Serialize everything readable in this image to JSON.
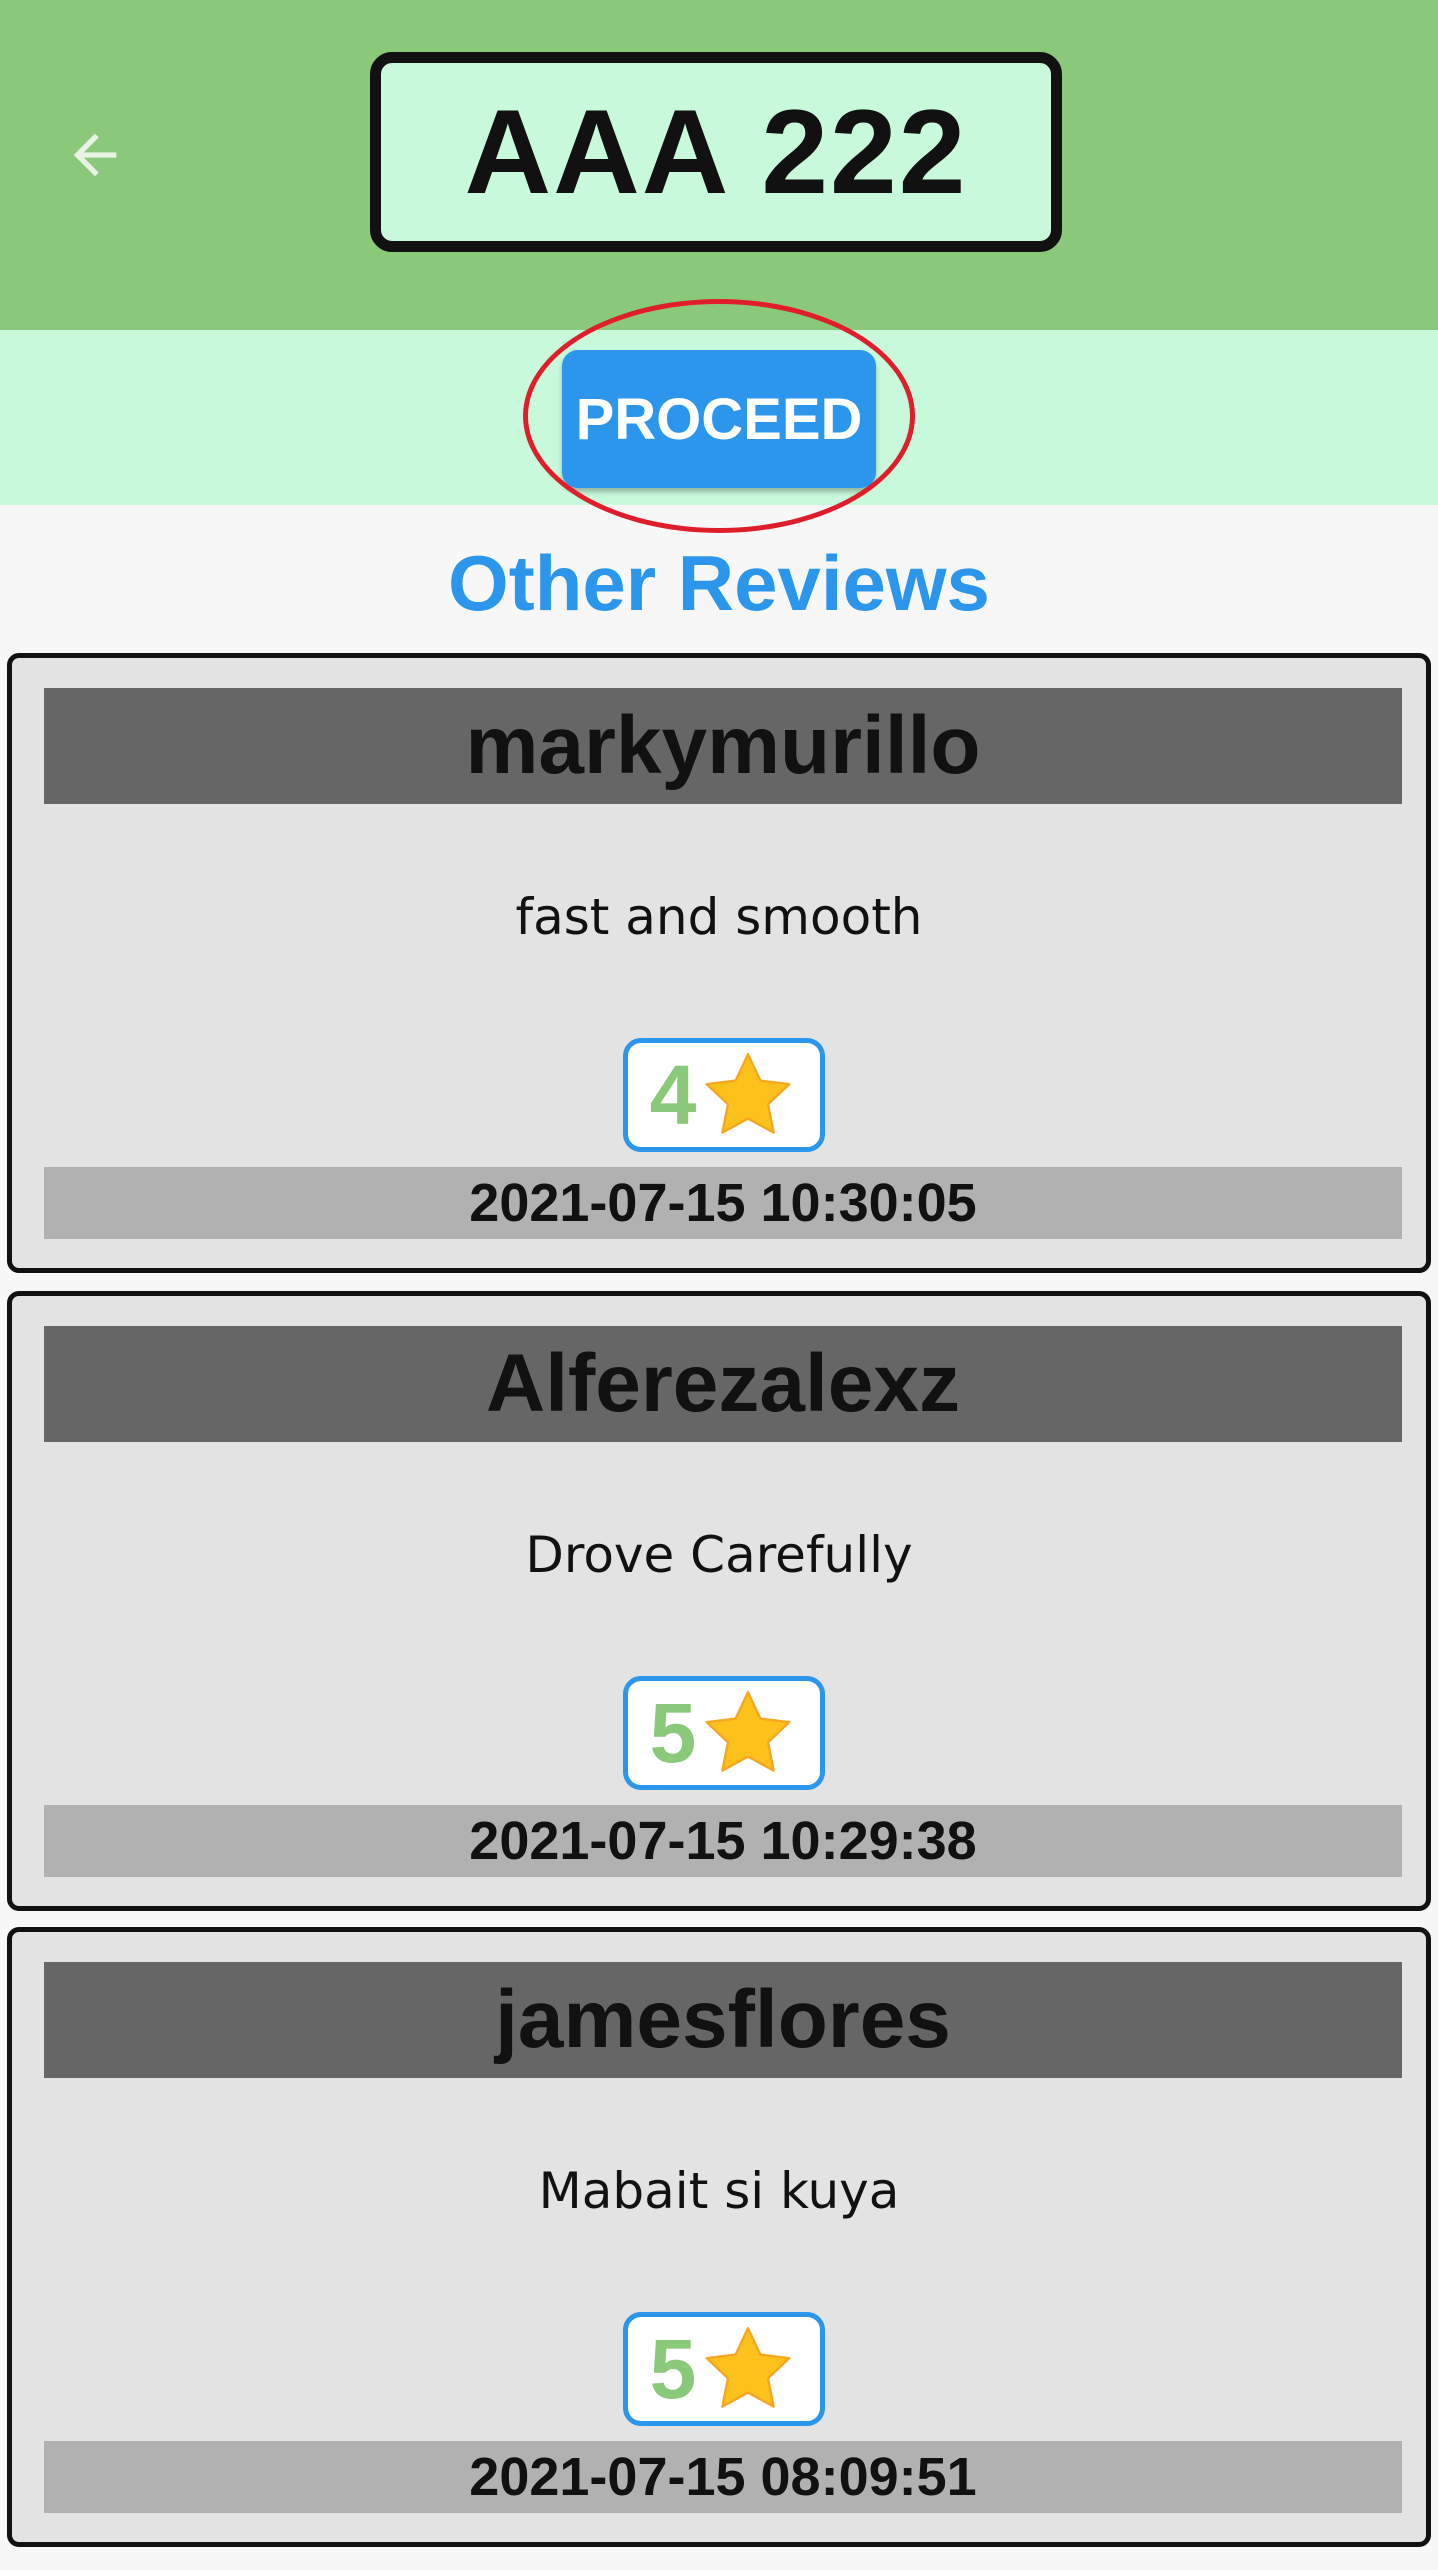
{
  "header": {
    "plate_number": "AAA 222",
    "back_icon": "arrow-left-icon",
    "background_color": "#8ac87a"
  },
  "actions": {
    "proceed_label": "PROCEED",
    "proceed_color": "#2b96ec",
    "highlight_color": "#e01e2b"
  },
  "reviews_section": {
    "title": "Other Reviews",
    "title_color": "#2b96ec"
  },
  "reviews": [
    {
      "username": "markymurillo",
      "comment": "fast and smooth",
      "rating": "4",
      "date": "2021-07-15 10:30:05"
    },
    {
      "username": "Alferezalexz",
      "comment": "Drove Carefully",
      "rating": "5",
      "date": "2021-07-15 10:29:38"
    },
    {
      "username": "jamesflores",
      "comment": "Mabait si kuya",
      "rating": "5",
      "date": "2021-07-15 08:09:51"
    }
  ],
  "icons": {
    "rating_icon": "star-icon"
  }
}
